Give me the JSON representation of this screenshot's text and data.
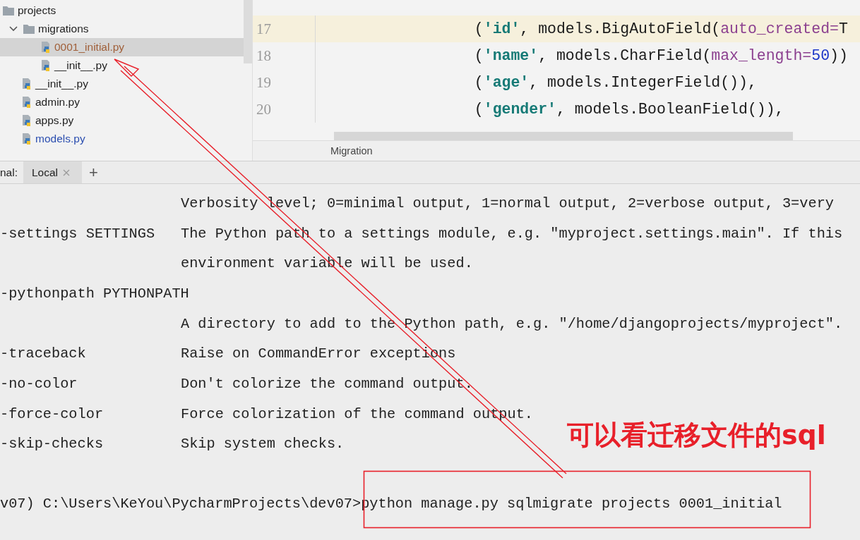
{
  "project_tree": {
    "items": [
      {
        "label": "projects",
        "kind": "folder",
        "selected": false,
        "color": "#1f1f1f",
        "children": [
          {
            "label": "migrations",
            "kind": "folder",
            "expanded": true,
            "selected": false,
            "color": "#1f1f1f",
            "children": [
              {
                "label": "0001_initial.py",
                "kind": "python",
                "selected": true,
                "color": "#a0603a"
              },
              {
                "label": "__init__.py",
                "kind": "python",
                "selected": false,
                "color": "#1f1f1f"
              }
            ]
          },
          {
            "label": "__init__.py",
            "kind": "python",
            "selected": false,
            "color": "#1f1f1f"
          },
          {
            "label": "admin.py",
            "kind": "python",
            "selected": false,
            "color": "#1f1f1f"
          },
          {
            "label": "apps.py",
            "kind": "python",
            "selected": false,
            "color": "#1f1f1f"
          },
          {
            "label": "models.py",
            "kind": "python",
            "selected": false,
            "color": "#2c4fb0"
          }
        ]
      }
    ]
  },
  "editor": {
    "lines": [
      {
        "number": "17",
        "current": true,
        "tokens": [
          {
            "kind": "plain",
            "text": "            ("
          },
          {
            "kind": "string",
            "text": "'id'"
          },
          {
            "kind": "plain",
            "text": ", models.BigAutoField("
          },
          {
            "kind": "param",
            "text": "auto_created="
          },
          {
            "kind": "plain",
            "text": "T"
          }
        ]
      },
      {
        "number": "18",
        "current": false,
        "tokens": [
          {
            "kind": "plain",
            "text": "            ("
          },
          {
            "kind": "string",
            "text": "'name'"
          },
          {
            "kind": "plain",
            "text": ", models.CharField("
          },
          {
            "kind": "param",
            "text": "max_length="
          },
          {
            "kind": "number",
            "text": "50"
          },
          {
            "kind": "plain",
            "text": "))"
          }
        ]
      },
      {
        "number": "19",
        "current": false,
        "tokens": [
          {
            "kind": "plain",
            "text": "            ("
          },
          {
            "kind": "string",
            "text": "'age'"
          },
          {
            "kind": "plain",
            "text": ", models.IntegerField()),"
          }
        ]
      },
      {
        "number": "20",
        "current": false,
        "tokens": [
          {
            "kind": "plain",
            "text": "            ("
          },
          {
            "kind": "string",
            "text": "'gender'"
          },
          {
            "kind": "plain",
            "text": ", models.BooleanField()),"
          }
        ]
      }
    ],
    "breadcrumb": "Migration"
  },
  "terminal": {
    "label": "nal:",
    "tabs": [
      {
        "label": "Local",
        "selected": true
      }
    ],
    "add_tab": "+",
    "lines": [
      {
        "description": "Verbosity level; 0=minimal output, 1=normal output, 2=verbose output, 3=very"
      },
      {
        "option": "-settings SETTINGS",
        "description": "The Python path to a settings module, e.g. \"myproject.settings.main\". If this"
      },
      {
        "description": "environment variable will be used."
      },
      {
        "option": "-pythonpath PYTHONPATH"
      },
      {
        "description": "A directory to add to the Python path, e.g. \"/home/djangoprojects/myproject\"."
      },
      {
        "option": "-traceback",
        "description": "Raise on CommandError exceptions"
      },
      {
        "option": "-no-color",
        "description": "Don't colorize the command output."
      },
      {
        "option": "-force-color",
        "description": "Force colorization of the command output."
      },
      {
        "option": "-skip-checks",
        "description": "Skip system checks."
      }
    ],
    "prompt": {
      "path": "v07) C:\\Users\\KeYou\\PycharmProjects\\dev07>",
      "command": "python manage.py sqlmigrate projects 0001_initial"
    }
  },
  "annotation": {
    "label": "可以看迁移文件的sql"
  }
}
